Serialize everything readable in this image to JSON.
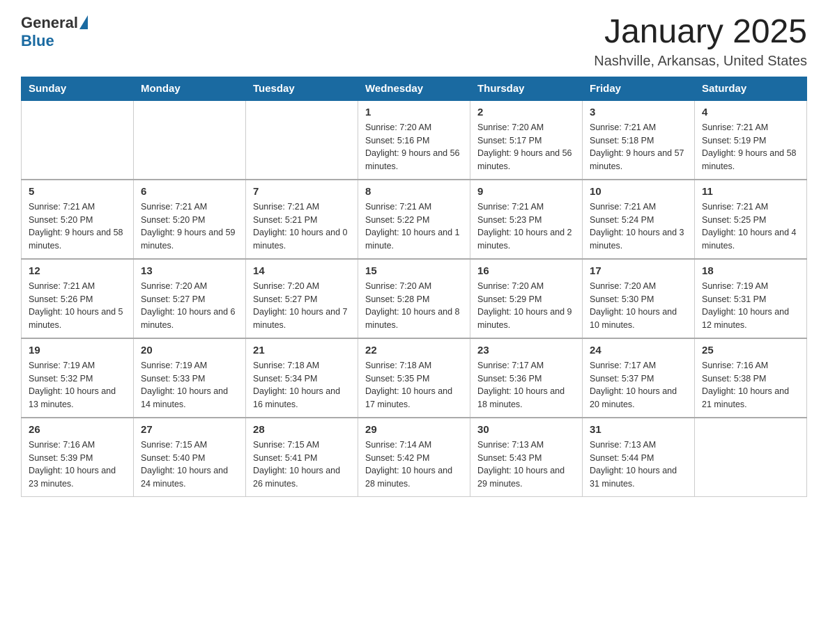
{
  "header": {
    "logo": {
      "text_general": "General",
      "triangle_symbol": "▲",
      "text_blue": "Blue"
    },
    "title": "January 2025",
    "location": "Nashville, Arkansas, United States"
  },
  "days_of_week": [
    "Sunday",
    "Monday",
    "Tuesday",
    "Wednesday",
    "Thursday",
    "Friday",
    "Saturday"
  ],
  "weeks": [
    [
      {
        "day": "",
        "sunrise": "",
        "sunset": "",
        "daylight": ""
      },
      {
        "day": "",
        "sunrise": "",
        "sunset": "",
        "daylight": ""
      },
      {
        "day": "",
        "sunrise": "",
        "sunset": "",
        "daylight": ""
      },
      {
        "day": "1",
        "sunrise": "Sunrise: 7:20 AM",
        "sunset": "Sunset: 5:16 PM",
        "daylight": "Daylight: 9 hours and 56 minutes."
      },
      {
        "day": "2",
        "sunrise": "Sunrise: 7:20 AM",
        "sunset": "Sunset: 5:17 PM",
        "daylight": "Daylight: 9 hours and 56 minutes."
      },
      {
        "day": "3",
        "sunrise": "Sunrise: 7:21 AM",
        "sunset": "Sunset: 5:18 PM",
        "daylight": "Daylight: 9 hours and 57 minutes."
      },
      {
        "day": "4",
        "sunrise": "Sunrise: 7:21 AM",
        "sunset": "Sunset: 5:19 PM",
        "daylight": "Daylight: 9 hours and 58 minutes."
      }
    ],
    [
      {
        "day": "5",
        "sunrise": "Sunrise: 7:21 AM",
        "sunset": "Sunset: 5:20 PM",
        "daylight": "Daylight: 9 hours and 58 minutes."
      },
      {
        "day": "6",
        "sunrise": "Sunrise: 7:21 AM",
        "sunset": "Sunset: 5:20 PM",
        "daylight": "Daylight: 9 hours and 59 minutes."
      },
      {
        "day": "7",
        "sunrise": "Sunrise: 7:21 AM",
        "sunset": "Sunset: 5:21 PM",
        "daylight": "Daylight: 10 hours and 0 minutes."
      },
      {
        "day": "8",
        "sunrise": "Sunrise: 7:21 AM",
        "sunset": "Sunset: 5:22 PM",
        "daylight": "Daylight: 10 hours and 1 minute."
      },
      {
        "day": "9",
        "sunrise": "Sunrise: 7:21 AM",
        "sunset": "Sunset: 5:23 PM",
        "daylight": "Daylight: 10 hours and 2 minutes."
      },
      {
        "day": "10",
        "sunrise": "Sunrise: 7:21 AM",
        "sunset": "Sunset: 5:24 PM",
        "daylight": "Daylight: 10 hours and 3 minutes."
      },
      {
        "day": "11",
        "sunrise": "Sunrise: 7:21 AM",
        "sunset": "Sunset: 5:25 PM",
        "daylight": "Daylight: 10 hours and 4 minutes."
      }
    ],
    [
      {
        "day": "12",
        "sunrise": "Sunrise: 7:21 AM",
        "sunset": "Sunset: 5:26 PM",
        "daylight": "Daylight: 10 hours and 5 minutes."
      },
      {
        "day": "13",
        "sunrise": "Sunrise: 7:20 AM",
        "sunset": "Sunset: 5:27 PM",
        "daylight": "Daylight: 10 hours and 6 minutes."
      },
      {
        "day": "14",
        "sunrise": "Sunrise: 7:20 AM",
        "sunset": "Sunset: 5:27 PM",
        "daylight": "Daylight: 10 hours and 7 minutes."
      },
      {
        "day": "15",
        "sunrise": "Sunrise: 7:20 AM",
        "sunset": "Sunset: 5:28 PM",
        "daylight": "Daylight: 10 hours and 8 minutes."
      },
      {
        "day": "16",
        "sunrise": "Sunrise: 7:20 AM",
        "sunset": "Sunset: 5:29 PM",
        "daylight": "Daylight: 10 hours and 9 minutes."
      },
      {
        "day": "17",
        "sunrise": "Sunrise: 7:20 AM",
        "sunset": "Sunset: 5:30 PM",
        "daylight": "Daylight: 10 hours and 10 minutes."
      },
      {
        "day": "18",
        "sunrise": "Sunrise: 7:19 AM",
        "sunset": "Sunset: 5:31 PM",
        "daylight": "Daylight: 10 hours and 12 minutes."
      }
    ],
    [
      {
        "day": "19",
        "sunrise": "Sunrise: 7:19 AM",
        "sunset": "Sunset: 5:32 PM",
        "daylight": "Daylight: 10 hours and 13 minutes."
      },
      {
        "day": "20",
        "sunrise": "Sunrise: 7:19 AM",
        "sunset": "Sunset: 5:33 PM",
        "daylight": "Daylight: 10 hours and 14 minutes."
      },
      {
        "day": "21",
        "sunrise": "Sunrise: 7:18 AM",
        "sunset": "Sunset: 5:34 PM",
        "daylight": "Daylight: 10 hours and 16 minutes."
      },
      {
        "day": "22",
        "sunrise": "Sunrise: 7:18 AM",
        "sunset": "Sunset: 5:35 PM",
        "daylight": "Daylight: 10 hours and 17 minutes."
      },
      {
        "day": "23",
        "sunrise": "Sunrise: 7:17 AM",
        "sunset": "Sunset: 5:36 PM",
        "daylight": "Daylight: 10 hours and 18 minutes."
      },
      {
        "day": "24",
        "sunrise": "Sunrise: 7:17 AM",
        "sunset": "Sunset: 5:37 PM",
        "daylight": "Daylight: 10 hours and 20 minutes."
      },
      {
        "day": "25",
        "sunrise": "Sunrise: 7:16 AM",
        "sunset": "Sunset: 5:38 PM",
        "daylight": "Daylight: 10 hours and 21 minutes."
      }
    ],
    [
      {
        "day": "26",
        "sunrise": "Sunrise: 7:16 AM",
        "sunset": "Sunset: 5:39 PM",
        "daylight": "Daylight: 10 hours and 23 minutes."
      },
      {
        "day": "27",
        "sunrise": "Sunrise: 7:15 AM",
        "sunset": "Sunset: 5:40 PM",
        "daylight": "Daylight: 10 hours and 24 minutes."
      },
      {
        "day": "28",
        "sunrise": "Sunrise: 7:15 AM",
        "sunset": "Sunset: 5:41 PM",
        "daylight": "Daylight: 10 hours and 26 minutes."
      },
      {
        "day": "29",
        "sunrise": "Sunrise: 7:14 AM",
        "sunset": "Sunset: 5:42 PM",
        "daylight": "Daylight: 10 hours and 28 minutes."
      },
      {
        "day": "30",
        "sunrise": "Sunrise: 7:13 AM",
        "sunset": "Sunset: 5:43 PM",
        "daylight": "Daylight: 10 hours and 29 minutes."
      },
      {
        "day": "31",
        "sunrise": "Sunrise: 7:13 AM",
        "sunset": "Sunset: 5:44 PM",
        "daylight": "Daylight: 10 hours and 31 minutes."
      },
      {
        "day": "",
        "sunrise": "",
        "sunset": "",
        "daylight": ""
      }
    ]
  ]
}
